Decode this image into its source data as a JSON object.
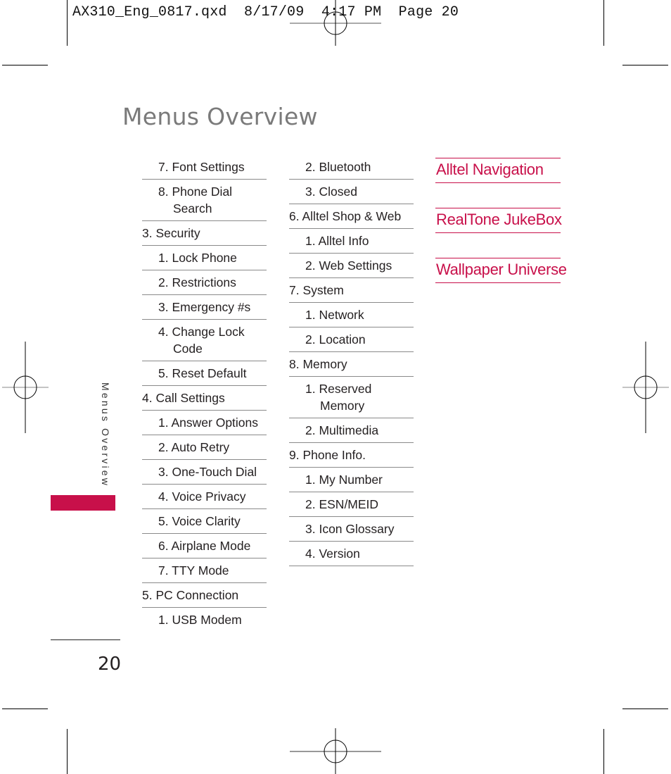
{
  "slug": {
    "text": "AX310_Eng_0817.qxd  8/17/09  4:17 PM  Page 20"
  },
  "page": {
    "title": "Menus Overview",
    "side_label": "Menus Overview",
    "number": "20",
    "accent_color": "#c8104a"
  },
  "menu_column_1": [
    {
      "label": "7.  Font Settings",
      "level": 2
    },
    {
      "label": "8. Phone Dial",
      "label2": "Search",
      "level": 2
    },
    {
      "label": "3. Security",
      "level": 1
    },
    {
      "label": "1. Lock Phone",
      "level": 2
    },
    {
      "label": "2. Restrictions",
      "level": 2
    },
    {
      "label": "3. Emergency #s",
      "level": 2
    },
    {
      "label": "4. Change Lock",
      "label2": "Code",
      "level": 2
    },
    {
      "label": "5. Reset Default",
      "level": 2
    },
    {
      "label": "4. Call Settings",
      "level": 1
    },
    {
      "label": "1. Answer Options",
      "level": 2
    },
    {
      "label": "2. Auto Retry",
      "level": 2
    },
    {
      "label": "3. One-Touch Dial",
      "level": 2
    },
    {
      "label": "4. Voice Privacy",
      "level": 2
    },
    {
      "label": "5. Voice Clarity",
      "level": 2
    },
    {
      "label": "6. Airplane Mode",
      "level": 2
    },
    {
      "label": "7. TTY Mode",
      "level": 2
    },
    {
      "label": "5. PC Connection",
      "level": 1
    },
    {
      "label": "1. USB Modem",
      "level": 2
    }
  ],
  "menu_column_2": [
    {
      "label": "2. Bluetooth",
      "level": 2
    },
    {
      "label": "3. Closed",
      "level": 2
    },
    {
      "label": "6. Alltel Shop & Web",
      "level": 1
    },
    {
      "label": "1. Alltel Info",
      "level": 2
    },
    {
      "label": "2. Web Settings",
      "level": 2
    },
    {
      "label": "7.  System",
      "level": 1
    },
    {
      "label": "1. Network",
      "level": 2
    },
    {
      "label": "2. Location",
      "level": 2
    },
    {
      "label": "8. Memory",
      "level": 1
    },
    {
      "label": "1. Reserved",
      "label2": "Memory",
      "level": 2
    },
    {
      "label": "2. Multimedia",
      "level": 2
    },
    {
      "label": "9. Phone Info.",
      "level": 1
    },
    {
      "label": "1. My Number",
      "level": 2
    },
    {
      "label": "2. ESN/MEID",
      "level": 2
    },
    {
      "label": "3. Icon Glossary",
      "level": 2
    },
    {
      "label": "4. Version",
      "level": 2
    }
  ],
  "apps": [
    {
      "label": "Alltel Navigation"
    },
    {
      "label": "RealTone JukeBox"
    },
    {
      "label": "Wallpaper Universe"
    }
  ]
}
